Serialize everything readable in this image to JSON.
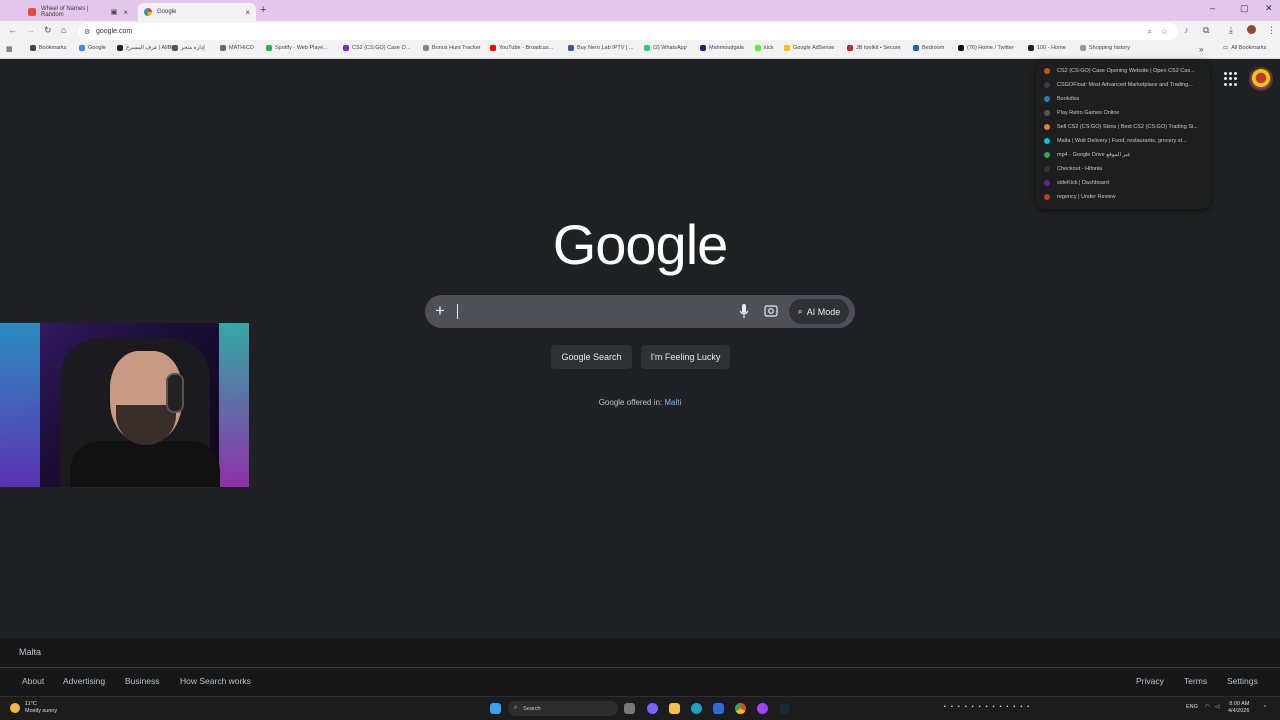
{
  "browser": {
    "tabs": [
      {
        "title": "Wheel of Names | Random",
        "active": false
      },
      {
        "title": "Google",
        "active": true
      }
    ],
    "new_tab_icon": "plus-icon",
    "window_controls": [
      "minimize-icon",
      "maximize-icon",
      "close-icon"
    ],
    "address": "google.com",
    "bookmarks": [
      {
        "label": "Bookmarks",
        "color": "#444444"
      },
      {
        "label": "Google",
        "color": "#4285f4"
      },
      {
        "label": "غرف المسرح | AllBi...",
        "color": "#222222"
      },
      {
        "label": "إدارة متجر",
        "color": "#555555"
      },
      {
        "label": "MATHICO",
        "color": "#666666"
      },
      {
        "label": "Spotify - Web Playe...",
        "color": "#1db954"
      },
      {
        "label": "CS2 (CS:GO) Case O...",
        "color": "#7b2fd1"
      },
      {
        "label": "Bonus Hunt Tracker",
        "color": "#888888"
      },
      {
        "label": "YouTube - Broadcas...",
        "color": "#ff0000"
      },
      {
        "label": "Buy Nero Lab IPTV | ...",
        "color": "#3b5998"
      },
      {
        "label": "(2) WhatsApp",
        "color": "#25d366"
      },
      {
        "label": "Mahmoudgala",
        "color": "#1a237e"
      },
      {
        "label": "kick",
        "color": "#53fc18"
      },
      {
        "label": "Google AdSense",
        "color": "#fbbc05"
      },
      {
        "label": "JB toolkit • Secure",
        "color": "#c62828"
      },
      {
        "label": "Bedroom",
        "color": "#1565c0"
      },
      {
        "label": "(76) Home / Twitter",
        "color": "#111111"
      },
      {
        "label": "100 - Home",
        "color": "#222222"
      },
      {
        "label": "Shopping history",
        "color": "#999999"
      }
    ],
    "all_bookmarks": "All Bookmarks"
  },
  "dropdown": [
    {
      "label": "CS2 (CS:GO) Case Opening Website | Open CS2 Cas...",
      "color": "#d35400"
    },
    {
      "label": "CSGOFloat: Most Advanced Marketplace and Trading...",
      "color": "#2c3e50"
    },
    {
      "label": "Bookdiss",
      "color": "#2980b9"
    },
    {
      "label": "Play Retro Games Online",
      "color": "#555555"
    },
    {
      "label": "Sell CS2 (CS:GO) Skins | Best CS2 (CS:GO) Trading Si...",
      "color": "#e67e22"
    },
    {
      "label": "Malta | Wolt Delivery | Food, restaurants, grocery st...",
      "color": "#00c2e8"
    },
    {
      "label": "mp4 - Google Drive عبر الموقع",
      "color": "#34a853"
    },
    {
      "label": "Checkout - Hifonia",
      "color": "#333333"
    },
    {
      "label": "sideKick | Dashboard",
      "color": "#6a1b9a"
    },
    {
      "label": "regency | Under Review",
      "color": "#c0392b"
    }
  ],
  "google": {
    "logo": "Google",
    "search_placeholder": "",
    "ai_mode": "AI Mode",
    "search_button": "Google Search",
    "lucky_button": "I'm Feeling Lucky",
    "offered_prefix": "Google offered in:",
    "offered_language": "Malti"
  },
  "footer": {
    "country": "Malta",
    "left_links": [
      "About",
      "Advertising",
      "Business",
      "How Search works"
    ],
    "right_links": [
      "Privacy",
      "Terms",
      "Settings"
    ]
  },
  "taskbar": {
    "temperature": "11°C",
    "weather": "Mostly sunny",
    "search": "Search",
    "language": "ENG",
    "time": "8:00 AM",
    "date": "4/4/2026"
  }
}
